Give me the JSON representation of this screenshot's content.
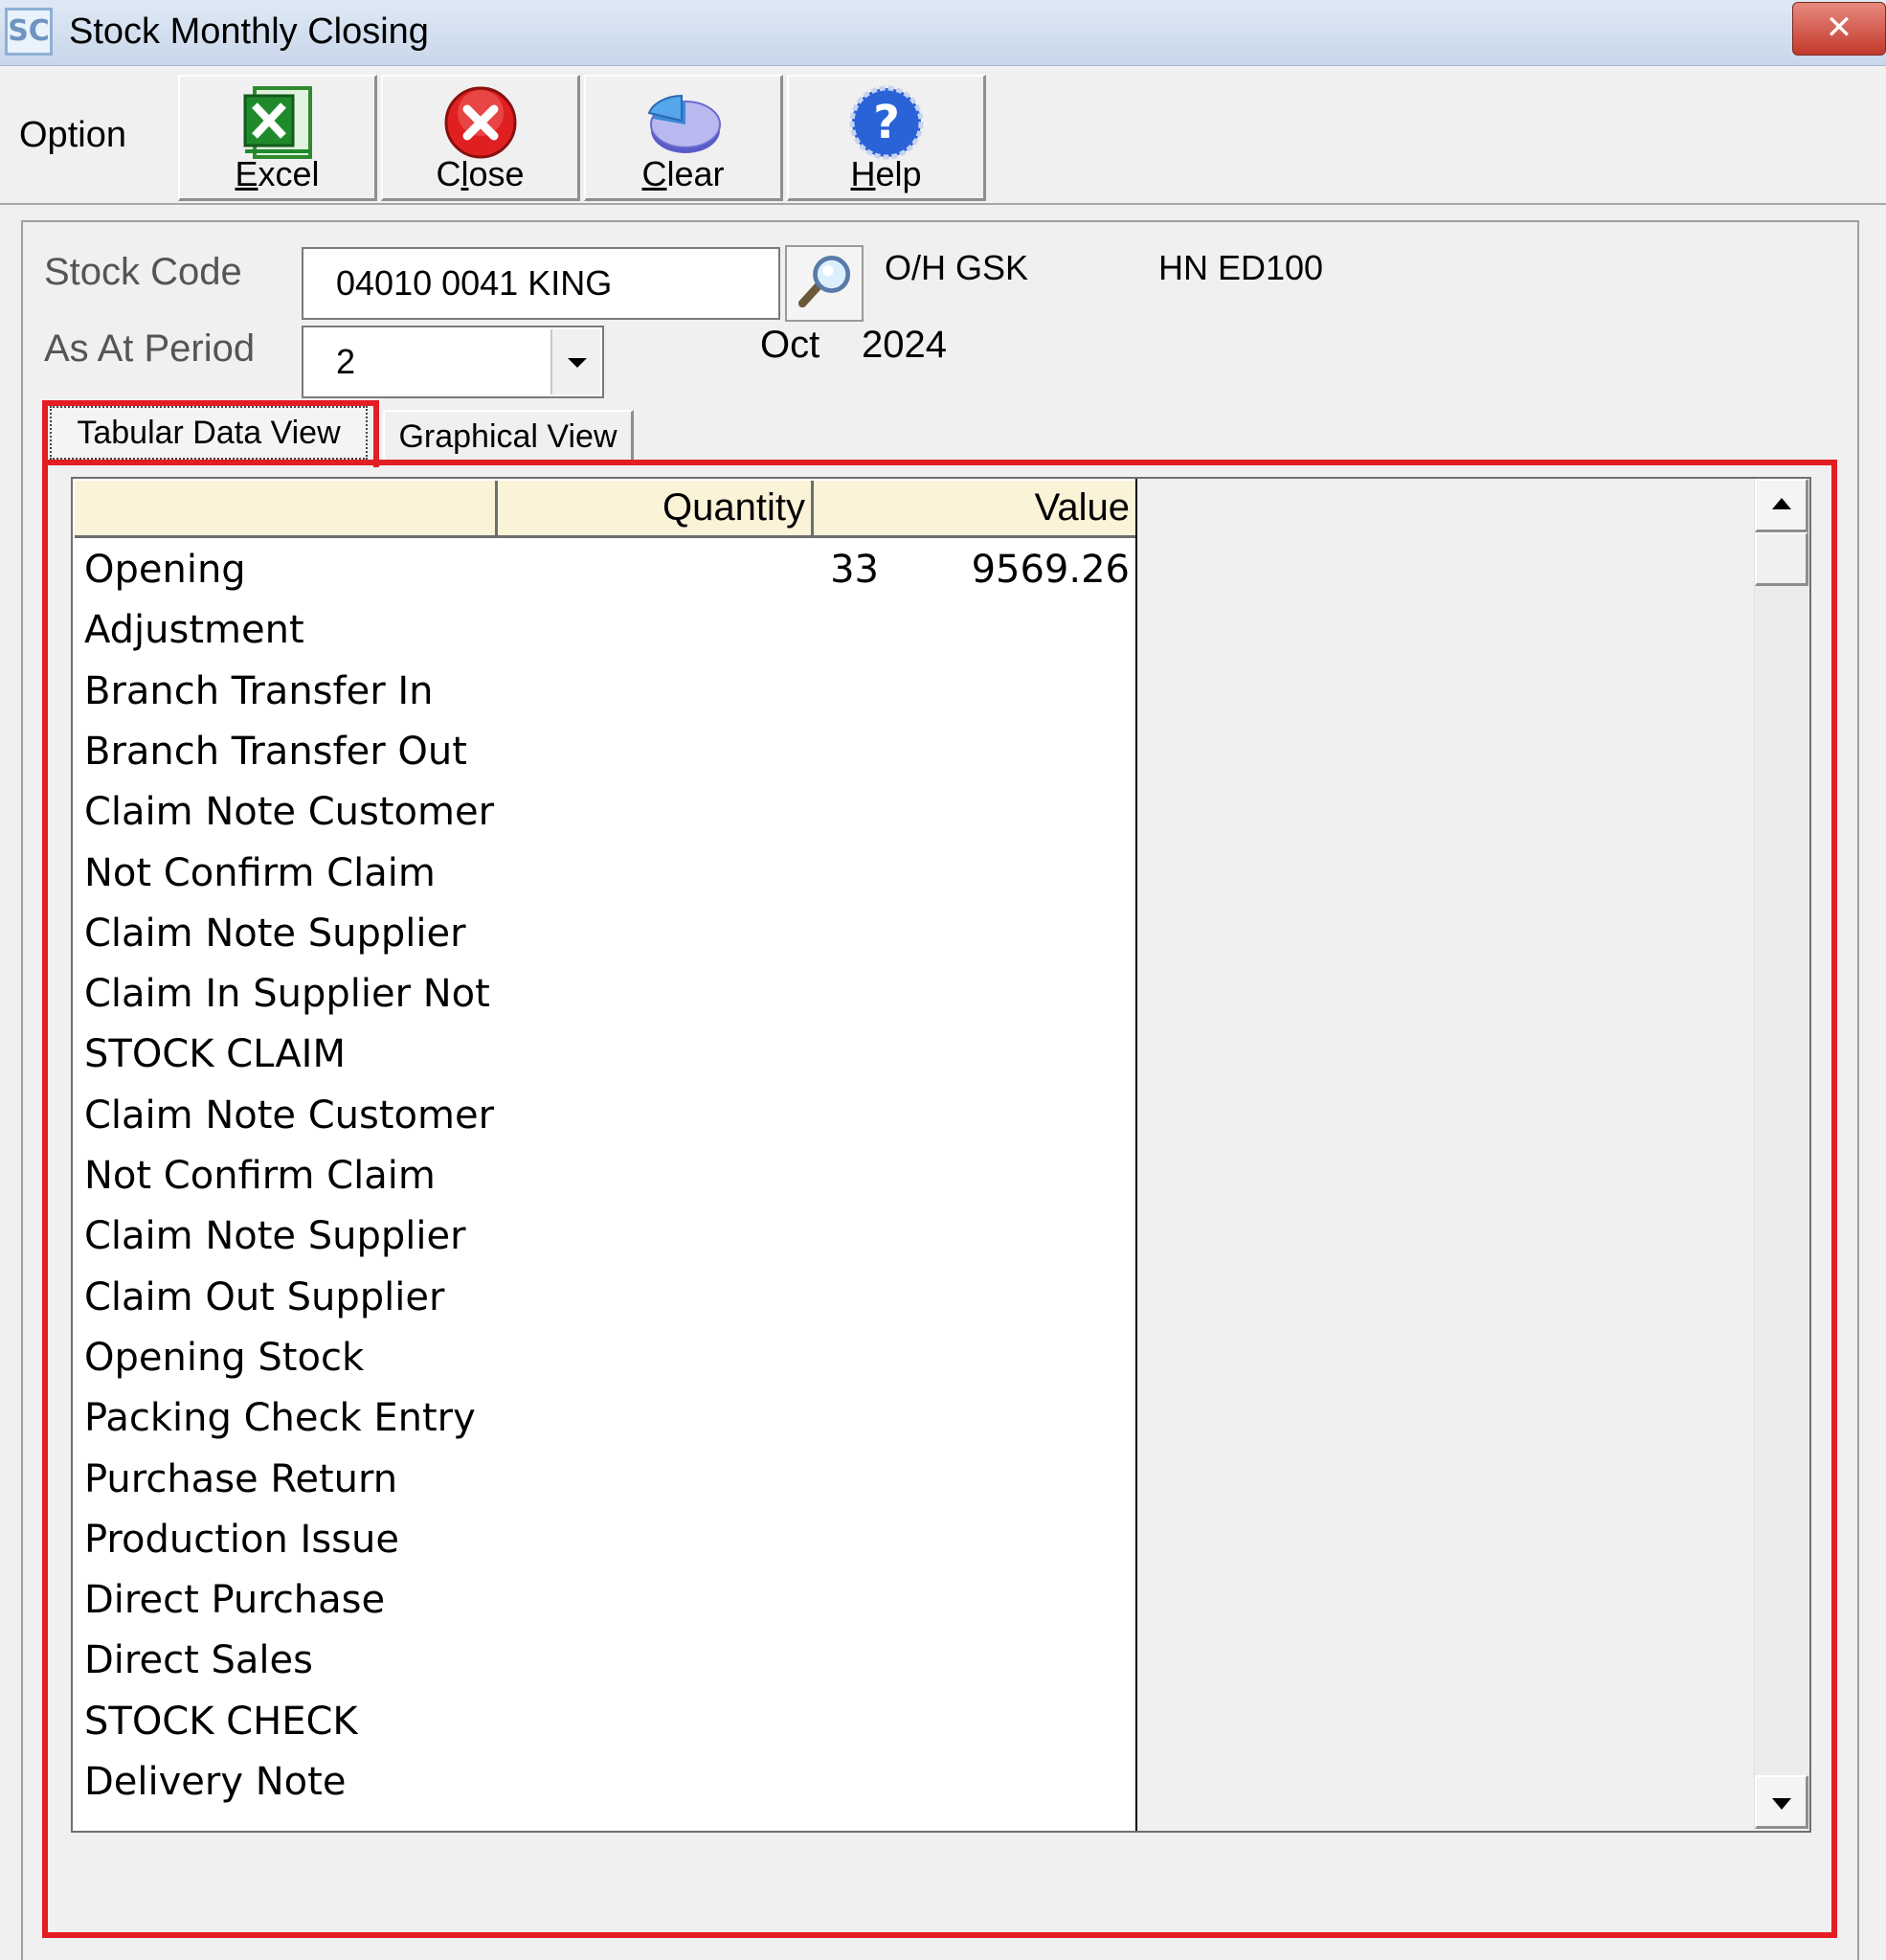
{
  "window": {
    "app_icon_text": "SC",
    "title": "Stock Monthly Closing",
    "close_symbol": "✕"
  },
  "toolbar": {
    "option_label": "Option",
    "buttons": [
      {
        "label": "Excel",
        "icon": "excel-icon"
      },
      {
        "label": "Close",
        "icon": "close-circle-icon"
      },
      {
        "label": "Clear",
        "icon": "pie-chart-icon"
      },
      {
        "label": "Help",
        "icon": "help-icon"
      }
    ]
  },
  "form": {
    "stock_code_label": "Stock Code",
    "stock_code_value": "04010 0041 KING",
    "info_1": "O/H GSK",
    "info_2": "HN ED100",
    "period_label": "As At Period",
    "period_value": "2",
    "month": "Oct",
    "year": "2024"
  },
  "tabs": [
    {
      "label": "Tabular Data View",
      "active": true
    },
    {
      "label": "Graphical View",
      "active": false
    }
  ],
  "grid": {
    "headers": [
      "",
      "Quantity",
      "Value"
    ],
    "rows": [
      [
        "Opening",
        "33",
        "9569.26"
      ],
      [
        "Adjustment",
        "",
        ""
      ],
      [
        "Branch Transfer In",
        "",
        ""
      ],
      [
        "Branch Transfer Out",
        "",
        ""
      ],
      [
        "Claim Note Customer",
        "",
        ""
      ],
      [
        "Not Confirm Claim",
        "",
        ""
      ],
      [
        "Claim Note Supplier",
        "",
        ""
      ],
      [
        "Claim In Supplier Not",
        "",
        ""
      ],
      [
        "STOCK CLAIM",
        "",
        ""
      ],
      [
        "Claim Note Customer",
        "",
        ""
      ],
      [
        "Not Confirm Claim",
        "",
        ""
      ],
      [
        "Claim Note Supplier",
        "",
        ""
      ],
      [
        "Claim Out Supplier",
        "",
        ""
      ],
      [
        "Opening Stock",
        "",
        ""
      ],
      [
        "Packing Check Entry",
        "",
        ""
      ],
      [
        "Purchase Return",
        "",
        ""
      ],
      [
        "Production Issue",
        "",
        ""
      ],
      [
        "Direct Purchase",
        "",
        ""
      ],
      [
        "Direct Sales",
        "",
        ""
      ],
      [
        "STOCK CHECK",
        "",
        ""
      ],
      [
        "Delivery Note",
        "",
        ""
      ]
    ]
  },
  "colors": {
    "highlight_frame": "#e31d24",
    "header_bg": "#fbf3d8"
  }
}
